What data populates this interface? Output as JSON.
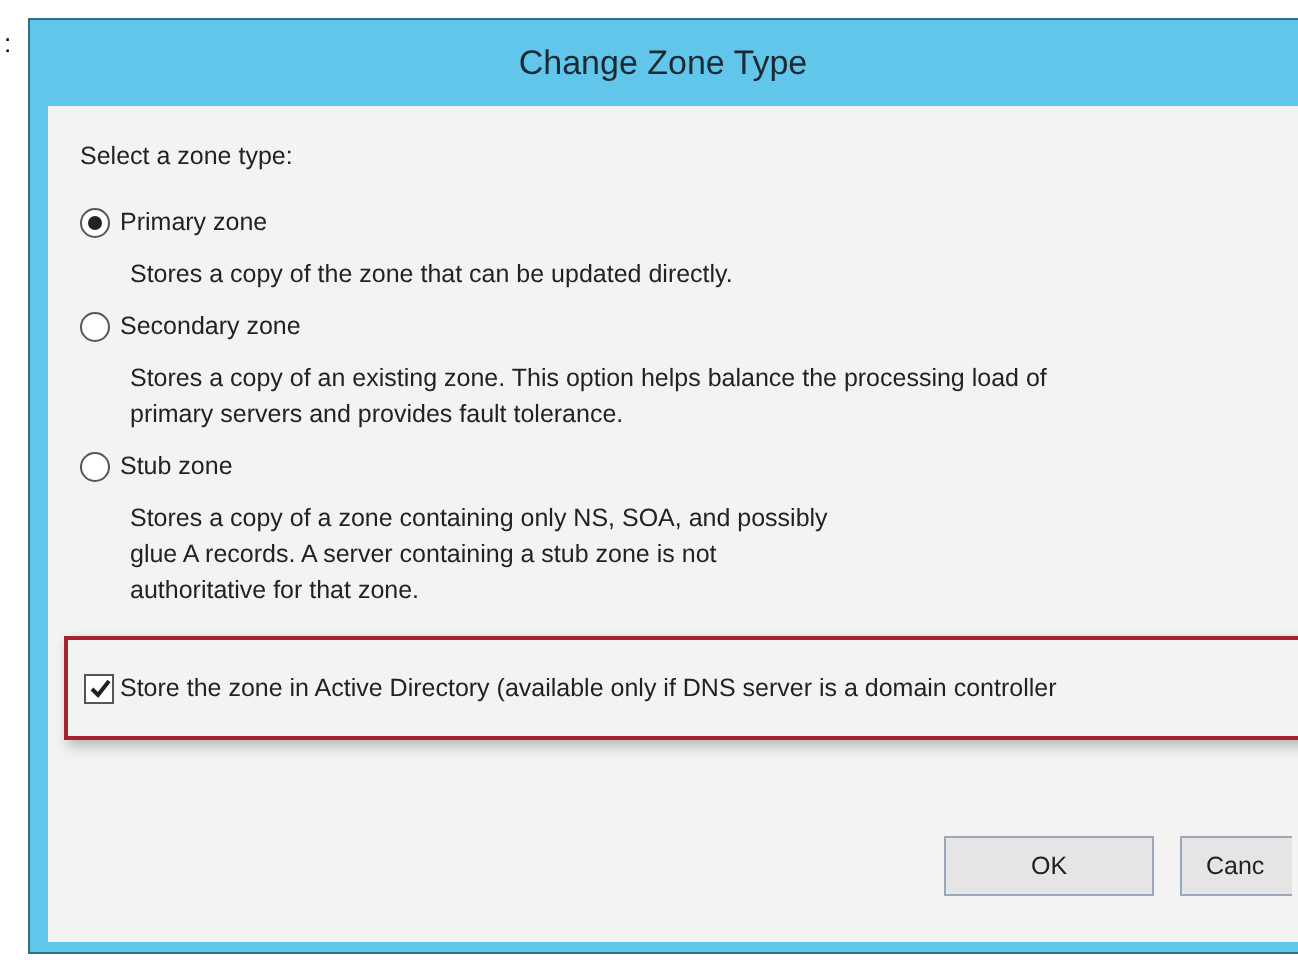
{
  "page_label": ":",
  "dialog": {
    "title": "Change Zone Type",
    "prompt": "Select a zone type:",
    "options": [
      {
        "label": "Primary zone",
        "selected": true,
        "description": [
          "Stores a copy of the zone that can be updated directly."
        ]
      },
      {
        "label": "Secondary zone",
        "selected": false,
        "description": [
          "Stores a copy of an existing zone. This option helps balance the processing load of",
          "primary servers and provides fault tolerance."
        ]
      },
      {
        "label": "Stub zone",
        "selected": false,
        "description": [
          "Stores a copy of a zone containing only NS, SOA, and possibly",
          "glue A records. A server containing a stub zone is not",
          "authoritative for that zone."
        ]
      }
    ],
    "store_option": {
      "label": "Store the zone in Active Directory (available only if DNS server is a domain controller",
      "checked": true,
      "highlighted": true
    },
    "buttons": [
      "OK",
      "Canc"
    ]
  }
}
